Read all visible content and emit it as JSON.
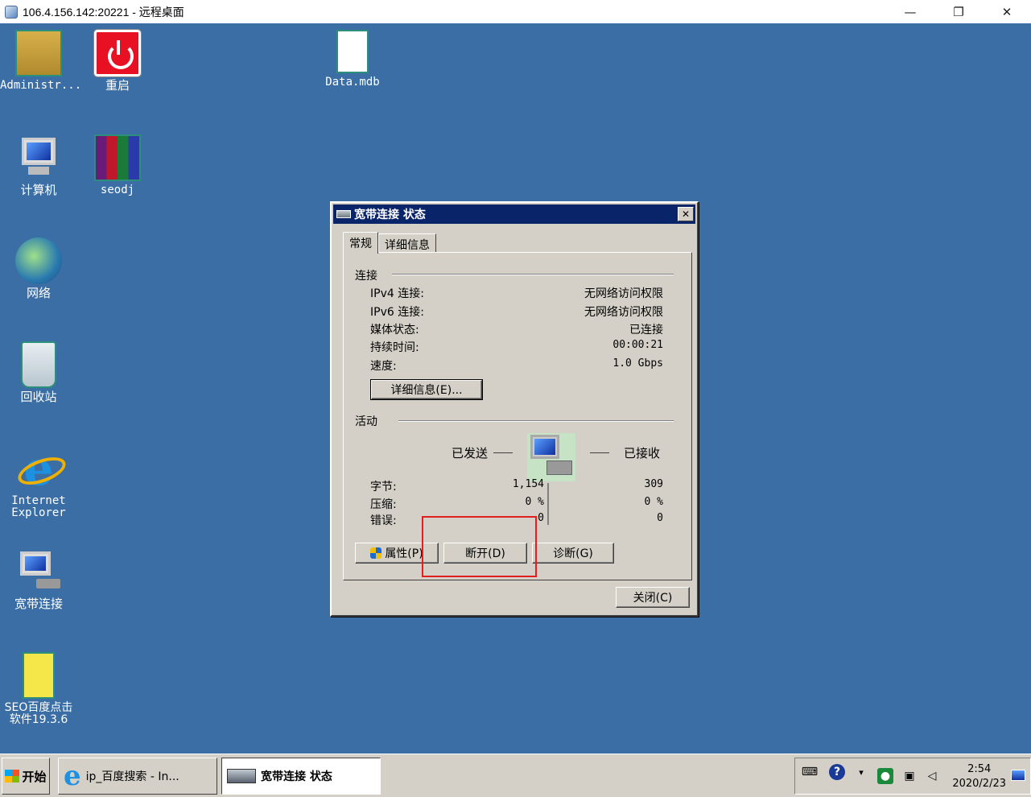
{
  "window": {
    "title": "106.4.156.142:20221 - 远程桌面",
    "minimize": "—",
    "maximize": "❐",
    "close": "✕"
  },
  "desktop_icons": [
    {
      "label": "Administr...",
      "icon": "user-folder-icon"
    },
    {
      "label": "重启",
      "icon": "restart-icon"
    },
    {
      "label": "Data.mdb",
      "icon": "file-icon"
    },
    {
      "label": "计算机",
      "icon": "computer-icon"
    },
    {
      "label": "seodj",
      "icon": "winrar-icon"
    },
    {
      "label": "网络",
      "icon": "network-icon"
    },
    {
      "label": "回收站",
      "icon": "recycle-bin-icon"
    },
    {
      "label_line1": "Internet",
      "label_line2": "Explorer",
      "icon": "internet-explorer-icon"
    },
    {
      "label": "宽带连接",
      "icon": "broadband-icon"
    },
    {
      "label_line1": "SEO百度点击",
      "label_line2": "软件19.3.6",
      "icon": "folder-icon"
    }
  ],
  "dialog": {
    "title": "宽带连接 状态",
    "close": "✕",
    "tabs": [
      "常规",
      "详细信息"
    ],
    "connection": {
      "group": "连接",
      "rows": [
        {
          "k": "IPv4 连接:",
          "v": "无网络访问权限"
        },
        {
          "k": "IPv6 连接:",
          "v": "无网络访问权限"
        },
        {
          "k": "媒体状态:",
          "v": "已连接"
        },
        {
          "k": "持续时间:",
          "v": "00:00:21"
        },
        {
          "k": "速度:",
          "v": "1.0 Gbps"
        }
      ],
      "details_button": "详细信息(E)..."
    },
    "activity": {
      "group": "活动",
      "sent": "已发送",
      "received": "已接收",
      "rows": [
        {
          "k": "字节:",
          "sent": "1,154",
          "received": "309"
        },
        {
          "k": "压缩:",
          "sent": "0 %",
          "received": "0 %"
        },
        {
          "k": "错误:",
          "sent": "0",
          "received": "0"
        }
      ]
    },
    "buttons": {
      "properties": "属性(P)",
      "disconnect": "断开(D)",
      "diagnose": "诊断(G)",
      "close": "关闭(C)"
    }
  },
  "taskbar": {
    "start": "开始",
    "items": [
      "ip_百度搜索 - In...",
      "宽带连接 状态"
    ],
    "clock_time": "2:54",
    "clock_date": "2020/2/23"
  },
  "colors": {
    "desktop": "#3a6ea5",
    "title_active": "#0a246a",
    "highlight": "#e02020"
  }
}
